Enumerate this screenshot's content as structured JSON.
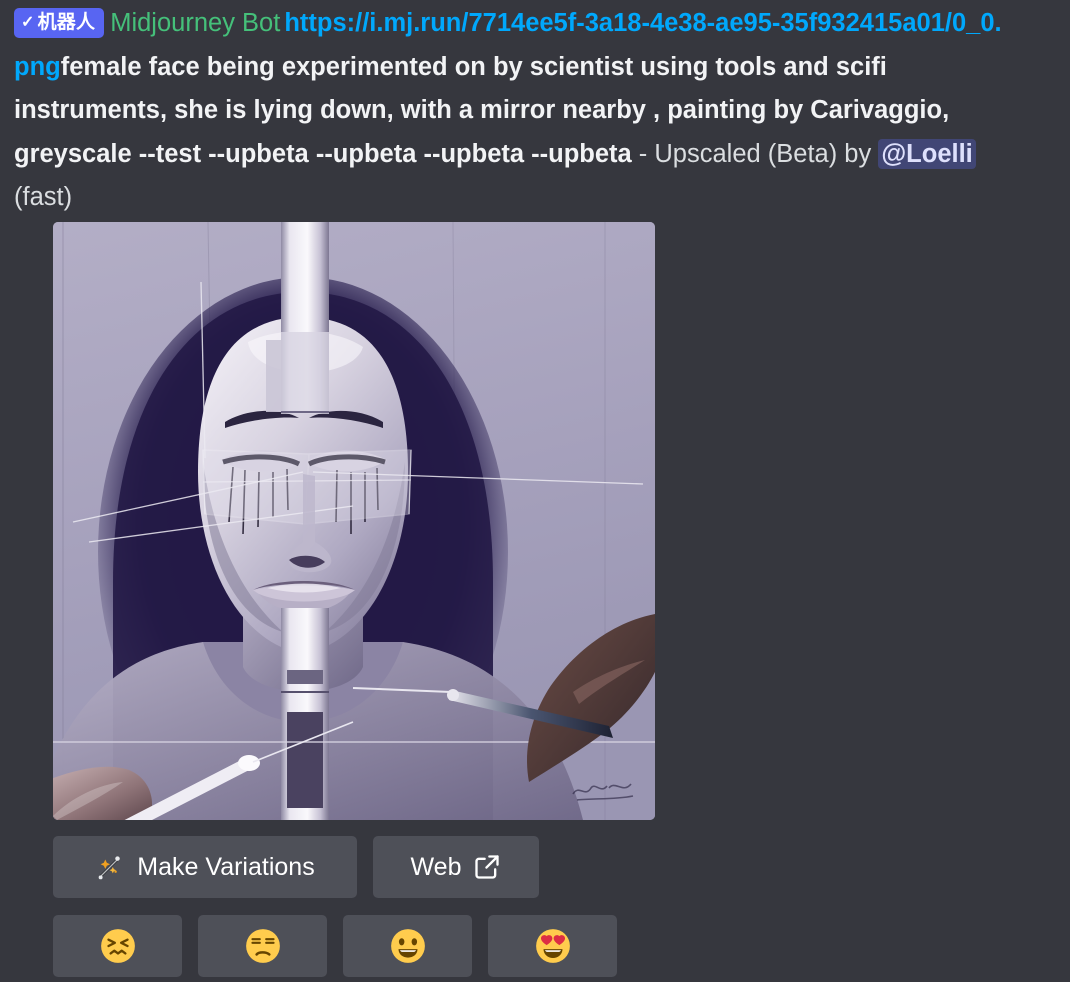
{
  "message": {
    "bot_badge": {
      "check": "✓",
      "label": "机器人"
    },
    "username": "Midjourney Bot",
    "image_url": "https://i.mj.run/7714ee5f-3a18-4e38-ae95-35f932415a01/0_0.png",
    "prompt": "female face being experimented on by scientist using tools and scifi instruments, she is lying down, with a mirror nearby , painting by Carivaggio, greyscale --test --upbeta --upbeta --upbeta --upbeta",
    "separator": " - ",
    "job_type": "Upscaled (Beta) by ",
    "mention": "@Loelli",
    "speed": " (fast)"
  },
  "attachment": {
    "alt": "Greyscale painting of a female face lying down being experimented on with scientific instruments, hands holding tools near her eyes and cheek, mirror panels across the face"
  },
  "buttons": [
    {
      "id": "make-variations",
      "label": "Make Variations",
      "icon": "magic-wand-icon"
    },
    {
      "id": "web",
      "label": "Web",
      "icon": "external-link-icon"
    }
  ],
  "reactions": [
    {
      "id": "confounded",
      "icon": "confounded-face-emoji",
      "label": "😖"
    },
    {
      "id": "unamused",
      "icon": "unamused-face-emoji",
      "label": "😒"
    },
    {
      "id": "grinning",
      "icon": "grinning-face-emoji",
      "label": "😀"
    },
    {
      "id": "smiling-hearts",
      "icon": "smiling-face-with-hearts-emoji",
      "label": "😍"
    }
  ],
  "colors": {
    "background": "#36373E",
    "bot_badge": "#5865F2",
    "username": "#45C07A",
    "link": "#00A8FC",
    "text": "#DBDEE1",
    "button": "#4E5058",
    "mention_bg": "#414675"
  }
}
